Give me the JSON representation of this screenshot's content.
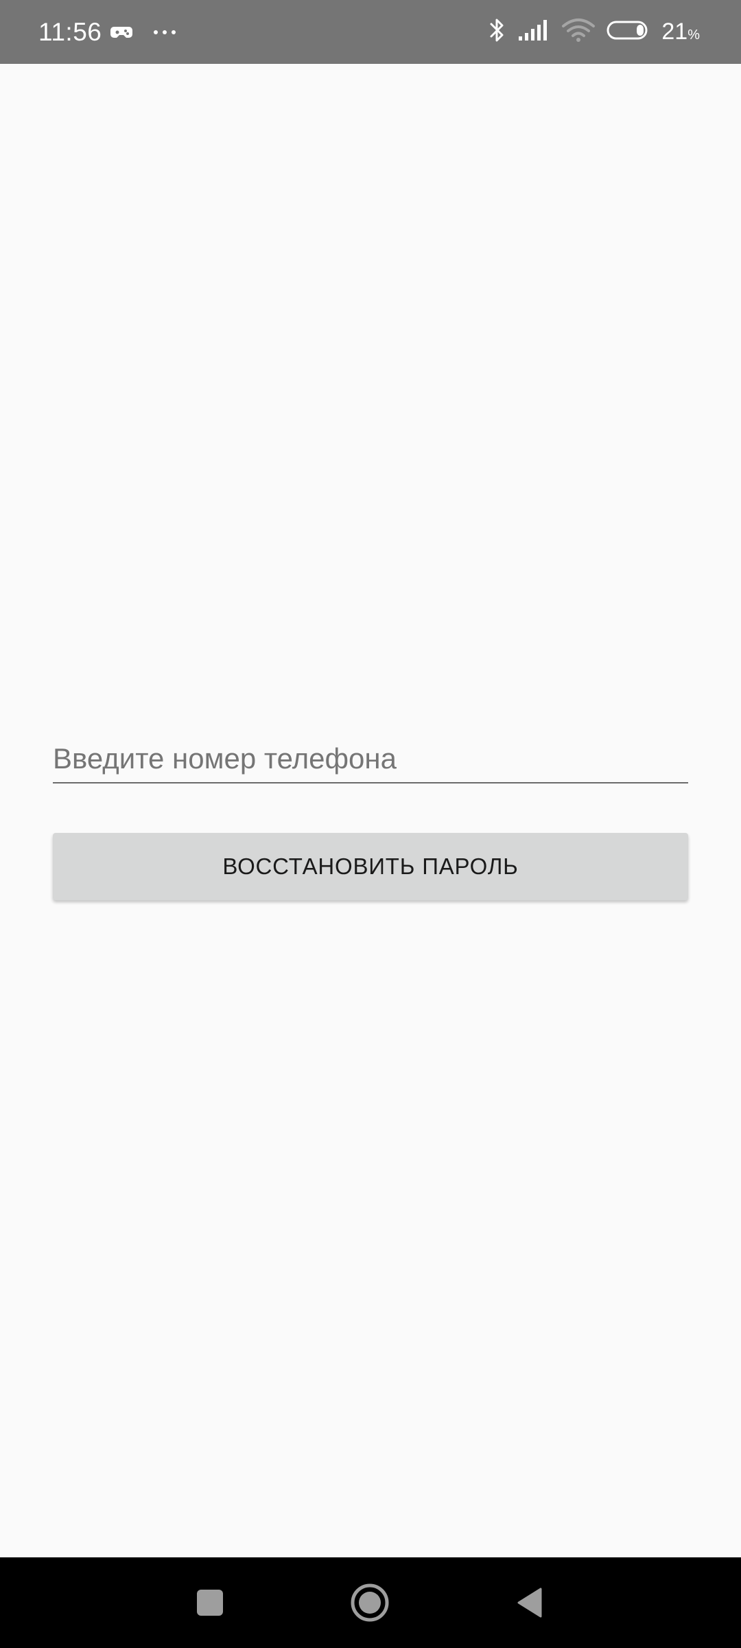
{
  "status_bar": {
    "time": "11:56",
    "battery_level": "21",
    "battery_unit": "%",
    "icons": [
      "game-controller-icon",
      "more-dots-icon",
      "bluetooth-icon",
      "signal-icon",
      "wifi-icon",
      "battery-icon"
    ]
  },
  "form": {
    "phone_placeholder": "Введите номер телефона",
    "phone_value": "",
    "restore_button_label": "ВОССТАНОВИТЬ ПАРОЛЬ"
  },
  "nav_bar": {
    "icons": [
      "recents-square-icon",
      "home-circle-icon",
      "back-triangle-icon"
    ]
  },
  "colors": {
    "status_bar_bg": "#757575",
    "background": "#fafafa",
    "button_bg": "#d6d7d7",
    "nav_bar_bg": "#000000"
  }
}
